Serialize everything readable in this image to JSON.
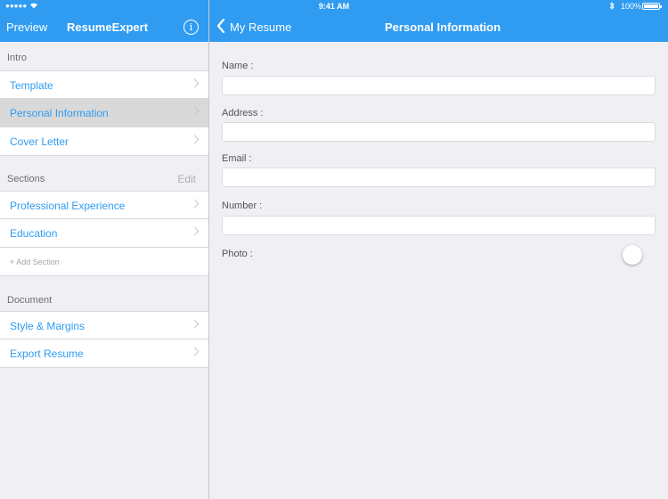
{
  "status_bar": {
    "signal": "●●●●●",
    "time": "9:41 AM",
    "battery": "100%"
  },
  "left_nav": {
    "preview_label": "Preview",
    "title": "ResumeExpert",
    "info_symbol": "i"
  },
  "right_nav": {
    "back_label": "My Resume",
    "title": "Personal Information"
  },
  "sidebar": {
    "intro_header": "Intro",
    "intro_items": [
      {
        "label": "Template"
      },
      {
        "label": "Personal Information"
      },
      {
        "label": "Cover Letter"
      }
    ],
    "sections_header": "Sections",
    "sections_edit": "Edit",
    "section_items": [
      {
        "label": "Professional Experience"
      },
      {
        "label": "Education"
      }
    ],
    "add_section_label": "+ Add Section",
    "document_header": "Document",
    "document_items": [
      {
        "label": "Style & Margins"
      },
      {
        "label": "Export Resume"
      }
    ]
  },
  "form": {
    "name_label": "Name :",
    "name_value": "",
    "address_label": "Address :",
    "address_value": "",
    "email_label": "Email :",
    "email_value": "",
    "number_label": "Number :",
    "number_value": "",
    "photo_label": "Photo :"
  },
  "colors": {
    "accent": "#2f9cf2",
    "background": "#efeff4",
    "selected_row": "#d9d9d9"
  }
}
